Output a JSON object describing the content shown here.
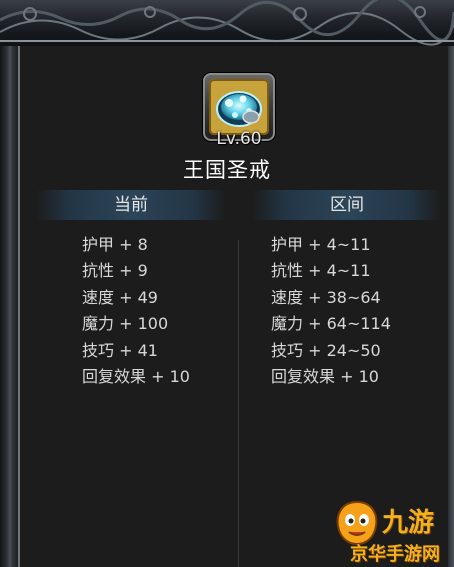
{
  "item": {
    "level": "Lv.60",
    "name": "王国圣戒",
    "icon": "ring-icon"
  },
  "columns": {
    "current_label": "当前",
    "range_label": "区间"
  },
  "current_stats": [
    "护甲 + 8",
    "抗性 + 9",
    "速度 + 49",
    "魔力 + 100",
    "技巧 + 41",
    "回复效果 + 10"
  ],
  "range_stats": [
    "护甲 + 4~11",
    "抗性 + 4~11",
    "速度 + 38~64",
    "魔力 + 64~114",
    "技巧 + 24~50",
    "回复效果 + 10"
  ],
  "watermark": {
    "brand": "九游",
    "sub": "京华手游网"
  },
  "colors": {
    "panel_bg": "#1c1c1c",
    "icon_frame": "#c8a23a",
    "header_band": "#2c4558",
    "watermark": "#f2b01c"
  }
}
